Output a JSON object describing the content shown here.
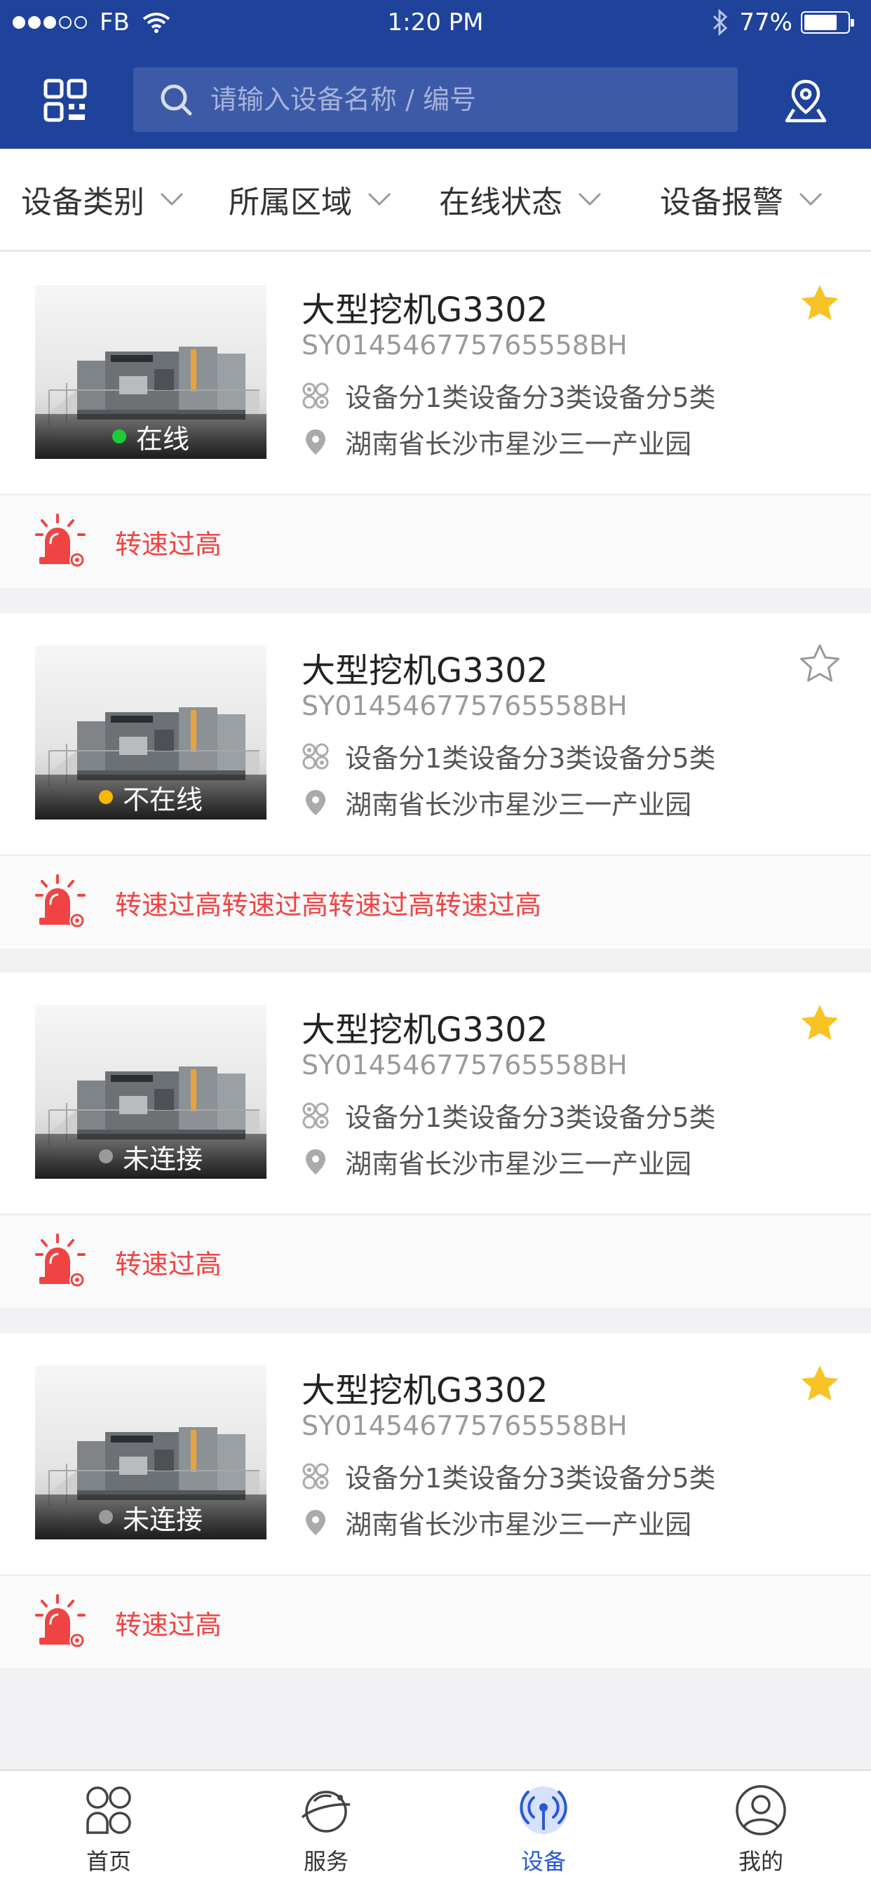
{
  "status_bar": {
    "carrier": "FB",
    "time": "1:20 PM",
    "battery": "77%",
    "signal_bars_filled": 3,
    "battery_level": 0.77
  },
  "header": {
    "search_placeholder": "请输入设备名称 / 编号",
    "qr_icon": "qrcode-scan-icon",
    "location_icon": "map-pin-icon"
  },
  "filters": [
    {
      "label": "设备类别"
    },
    {
      "label": "所属区域"
    },
    {
      "label": "在线状态"
    },
    {
      "label": "设备报警"
    }
  ],
  "devices": [
    {
      "name": "大型挖机G3302",
      "code": "SY014546775765558BH",
      "status": "在线",
      "status_color": "#1ec93a",
      "category": "设备分1类设备分3类设备分5类",
      "location": "湖南省长沙市星沙三一产业园",
      "favorited": true,
      "alarm": "转速过高"
    },
    {
      "name": "大型挖机G3302",
      "code": "SY014546775765558BH",
      "status": "不在线",
      "status_color": "#f5b800",
      "category": "设备分1类设备分3类设备分5类",
      "location": "湖南省长沙市星沙三一产业园",
      "favorited": false,
      "alarm": "转速过高转速过高转速过高转速过高"
    },
    {
      "name": "大型挖机G3302",
      "code": "SY014546775765558BH",
      "status": "未连接",
      "status_color": "#9a9a9a",
      "category": "设备分1类设备分3类设备分5类",
      "location": "湖南省长沙市星沙三一产业园",
      "favorited": true,
      "alarm": "转速过高"
    },
    {
      "name": "大型挖机G3302",
      "code": "SY014546775765558BH",
      "status": "未连接",
      "status_color": "#9a9a9a",
      "category": "设备分1类设备分3类设备分5类",
      "location": "湖南省长沙市星沙三一产业园",
      "favorited": true,
      "alarm": "转速过高"
    }
  ],
  "tabs": [
    {
      "label": "首页",
      "icon": "home-grid-icon",
      "active": false
    },
    {
      "label": "服务",
      "icon": "planet-service-icon",
      "active": false
    },
    {
      "label": "设备",
      "icon": "device-signal-icon",
      "active": true
    },
    {
      "label": "我的",
      "icon": "profile-icon",
      "active": false
    }
  ],
  "colors": {
    "header_bg": "#1f429b",
    "accent": "#2a57d6",
    "alarm": "#f04444",
    "star": "#f7c325"
  }
}
